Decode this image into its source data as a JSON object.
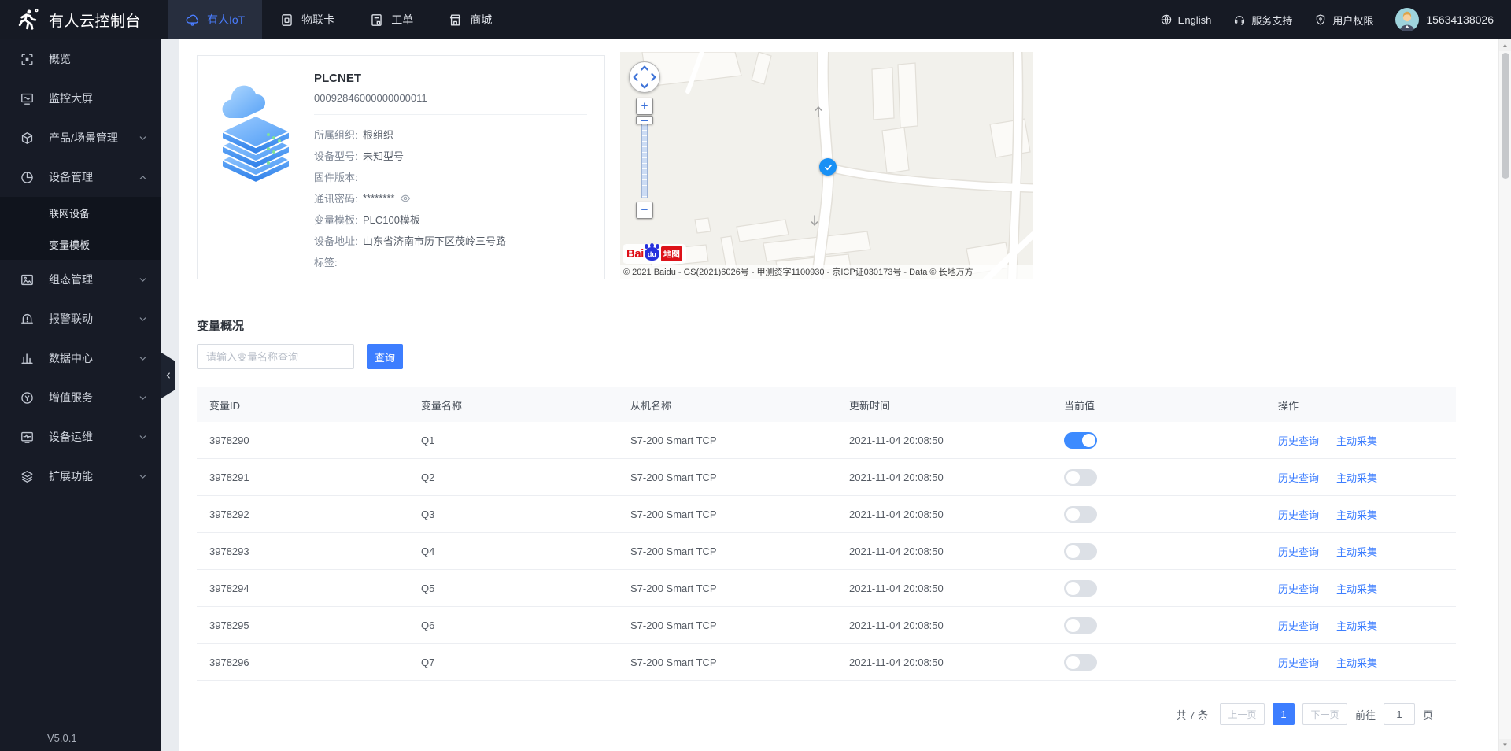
{
  "header": {
    "title": "有人云控制台",
    "tabs": [
      {
        "name": "usr-iot",
        "label": "有人IoT",
        "icon": "cloud",
        "active": true
      },
      {
        "name": "iot-card",
        "label": "物联卡",
        "icon": "sim-card",
        "active": false
      },
      {
        "name": "work-order",
        "label": "工单",
        "icon": "work-order",
        "active": false
      },
      {
        "name": "mall",
        "label": "商城",
        "icon": "mall",
        "active": false
      }
    ],
    "language": "English",
    "support": "服务支持",
    "permission": "用户权限",
    "phone": "15634138026"
  },
  "sidebar": {
    "version": "V5.0.1",
    "items": [
      {
        "name": "overview",
        "label": "概览",
        "icon": "overview"
      },
      {
        "name": "monitor-screen",
        "label": "监控大屏",
        "icon": "big-screen"
      },
      {
        "name": "product-scene-mgmt",
        "label": "产品/场景管理",
        "icon": "product",
        "chevron": "down"
      },
      {
        "name": "device-mgmt",
        "label": "设备管理",
        "icon": "device",
        "chevron": "up",
        "children": [
          {
            "name": "networked-devices",
            "label": "联网设备"
          },
          {
            "name": "variable-templates",
            "label": "变量模板"
          }
        ]
      },
      {
        "name": "scada-mgmt",
        "label": "组态管理",
        "icon": "scada",
        "chevron": "down"
      },
      {
        "name": "alarm-linkage",
        "label": "报警联动",
        "icon": "alarm",
        "chevron": "down"
      },
      {
        "name": "data-center",
        "label": "数据中心",
        "icon": "data-center",
        "chevron": "down"
      },
      {
        "name": "value-added-services",
        "label": "增值服务",
        "icon": "value-service",
        "chevron": "down"
      },
      {
        "name": "device-ops",
        "label": "设备运维",
        "icon": "device-ops",
        "chevron": "down"
      },
      {
        "name": "extended-functions",
        "label": "扩展功能",
        "icon": "extension",
        "chevron": "down"
      }
    ]
  },
  "device": {
    "name": "PLCNET",
    "sn": "00092846000000000011",
    "fields": [
      {
        "label": "所属组织:",
        "value": "根组织"
      },
      {
        "label": "设备型号:",
        "value": "未知型号"
      },
      {
        "label": "固件版本:",
        "value": ""
      },
      {
        "label": "通讯密码:",
        "value": "********",
        "eye": true
      },
      {
        "label": "变量模板:",
        "value": "PLC100模板"
      },
      {
        "label": "设备地址:",
        "value": "山东省济南市历下区茂岭三号路"
      },
      {
        "label": "标签:",
        "value": ""
      }
    ]
  },
  "map": {
    "logo": {
      "bai": "Bai",
      "du": "du",
      "tu": "地图"
    },
    "attribution": "© 2021 Baidu - GS(2021)6026号 - 甲测资字1100930 - 京ICP证030173号 - Data © 长地万方"
  },
  "variables": {
    "section_title": "变量概况",
    "search_placeholder": "请输入变量名称查询",
    "search_button": "查询",
    "columns": [
      "变量ID",
      "变量名称",
      "从机名称",
      "更新时间",
      "当前值",
      "操作"
    ],
    "actions": {
      "history": "历史查询",
      "collect": "主动采集"
    },
    "rows": [
      {
        "id": "3978290",
        "name": "Q1",
        "slave": "S7-200 Smart TCP",
        "time": "2021-11-04 20:08:50",
        "on": true
      },
      {
        "id": "3978291",
        "name": "Q2",
        "slave": "S7-200 Smart TCP",
        "time": "2021-11-04 20:08:50",
        "on": false
      },
      {
        "id": "3978292",
        "name": "Q3",
        "slave": "S7-200 Smart TCP",
        "time": "2021-11-04 20:08:50",
        "on": false
      },
      {
        "id": "3978293",
        "name": "Q4",
        "slave": "S7-200 Smart TCP",
        "time": "2021-11-04 20:08:50",
        "on": false
      },
      {
        "id": "3978294",
        "name": "Q5",
        "slave": "S7-200 Smart TCP",
        "time": "2021-11-04 20:08:50",
        "on": false
      },
      {
        "id": "3978295",
        "name": "Q6",
        "slave": "S7-200 Smart TCP",
        "time": "2021-11-04 20:08:50",
        "on": false
      },
      {
        "id": "3978296",
        "name": "Q7",
        "slave": "S7-200 Smart TCP",
        "time": "2021-11-04 20:08:50",
        "on": false
      }
    ],
    "pagination": {
      "total": "共 7 条",
      "prev": "上一页",
      "current": "1",
      "next": "下一页",
      "goto": "前往",
      "goto_value": "1",
      "unit": "页"
    }
  },
  "colors": {
    "accent": "#3D7EFF",
    "header_bg": "#161A24",
    "sidebar_bg": "#171B26",
    "submenu_bg": "#10141D",
    "toggle_on": "#3D8BFF",
    "toggle_off": "#DCE0E6",
    "marker_blue": "#1890F5",
    "baidu_red": "#DE0F17",
    "baidu_blue": "#2630DD"
  }
}
